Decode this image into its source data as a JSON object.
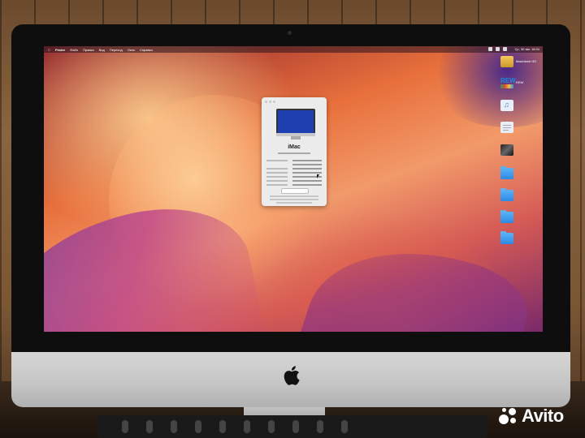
{
  "menubar": {
    "app_name": "Finder",
    "items": [
      "Файл",
      "Правка",
      "Вид",
      "Переход",
      "Окно",
      "Справка"
    ],
    "clock": "Ср, 30 авг. 18:34"
  },
  "about_window": {
    "title": "iMac"
  },
  "desktop_icons": [
    {
      "icon": "drive-icon",
      "label": "Macintosh HD"
    },
    {
      "icon": "rew-app-icon",
      "label": "REW"
    },
    {
      "icon": "music-file-icon",
      "label": ""
    },
    {
      "icon": "document-icon",
      "label": ""
    },
    {
      "icon": "photo-icon",
      "label": ""
    },
    {
      "icon": "folder-icon",
      "label": ""
    },
    {
      "icon": "folder-icon",
      "label": ""
    },
    {
      "icon": "folder-icon",
      "label": ""
    },
    {
      "icon": "folder-icon",
      "label": ""
    }
  ],
  "rew_badge": "REW",
  "watermark": "Avito",
  "colors": {
    "folder": "#3a9af0",
    "about_screen": "#1e3fb0",
    "wallpaper_main": "#e8703c"
  }
}
